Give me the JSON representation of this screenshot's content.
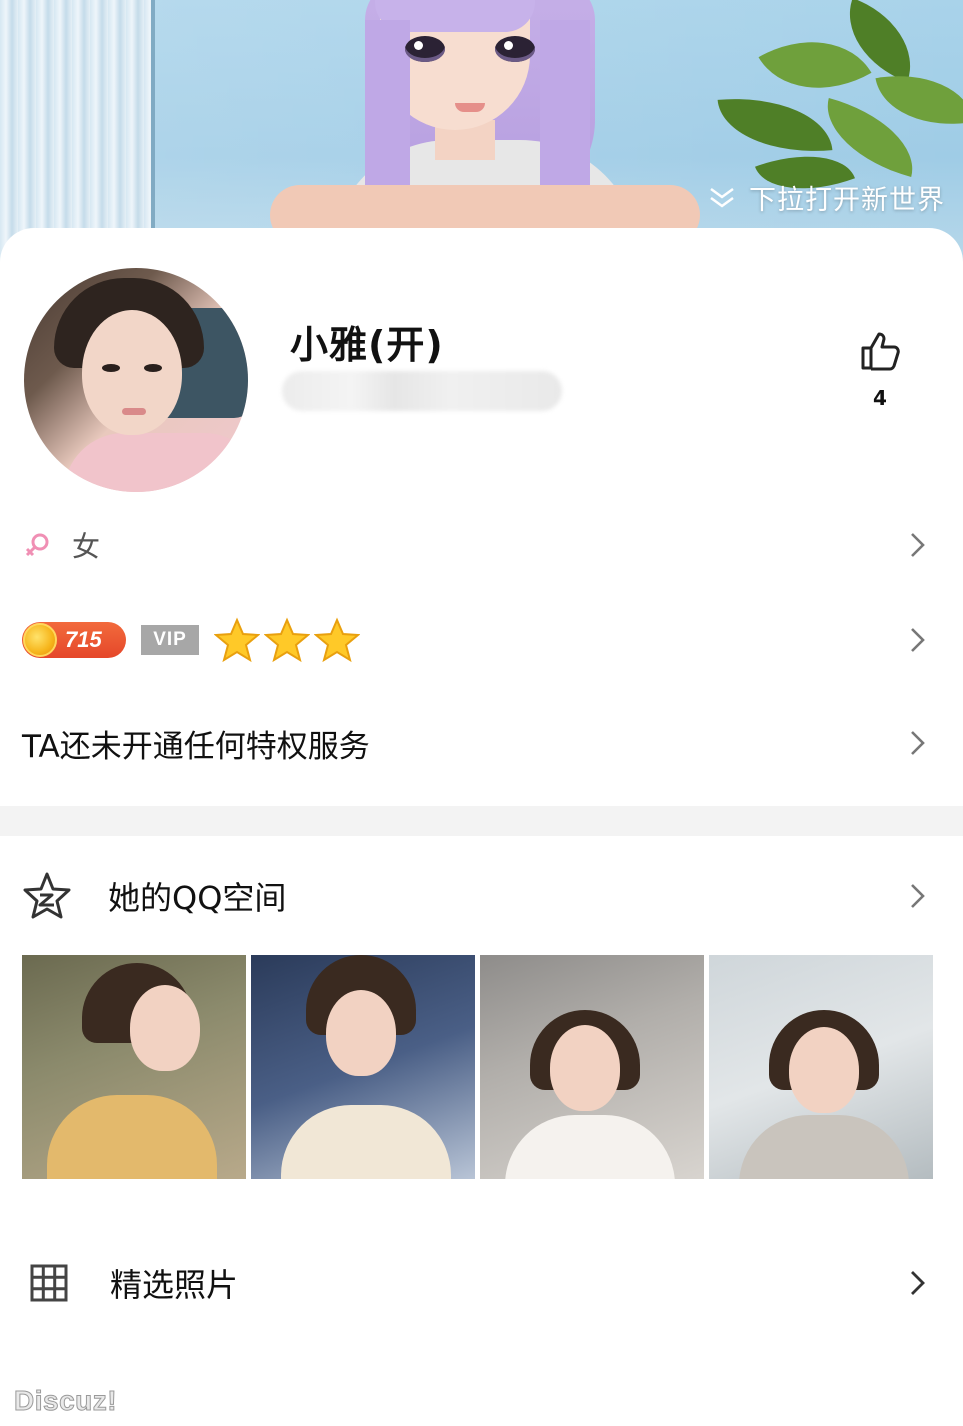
{
  "banner": {
    "pull_hint": "下拉打开新世界"
  },
  "profile": {
    "nickname": "小雅(开)",
    "like_count": "4",
    "gender": "女"
  },
  "level": {
    "coins": "715",
    "vip_label": "VIP",
    "star_count": 3
  },
  "privilege": {
    "text": "TA还未开通任何特权服务"
  },
  "qzone": {
    "title": "她的QQ空间",
    "photo_count": 4
  },
  "selected_photos": {
    "title": "精选照片"
  },
  "watermark": "Discuz!"
}
